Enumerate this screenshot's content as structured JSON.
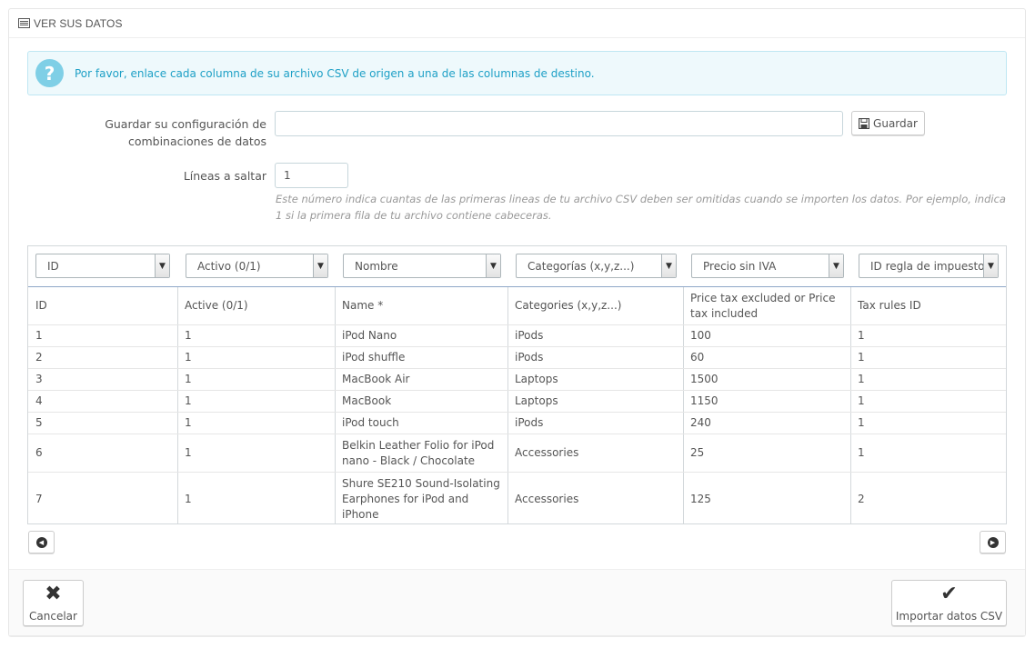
{
  "panel": {
    "title": "VER SUS DATOS",
    "icon": "list-icon"
  },
  "alert": {
    "icon": "question-icon",
    "text": "Por favor, enlace cada columna de su archivo CSV de origen a una de las columnas de destino."
  },
  "config": {
    "label_line1": "Guardar su configuración de",
    "label_line2": "combinaciones de datos",
    "value": "",
    "save_label": "Guardar",
    "save_icon": "save-icon"
  },
  "skip": {
    "label": "Líneas a saltar",
    "value": "1",
    "help": "Este número indica cuantas de las primeras lineas de tu archivo CSV deben ser omitidas cuando se importen los datos. Por ejemplo, indica 1 si la primera fila de tu archivo contiene cabeceras."
  },
  "mapping": [
    "ID",
    "Activo (0/1)",
    "Nombre",
    "Categorías (x,y,z...)",
    "Precio sin IVA",
    "ID regla de impuesto"
  ],
  "table": {
    "headers": [
      "ID",
      "Active (0/1)",
      "Name *",
      "Categories (x,y,z...)",
      "Price tax excluded or Price tax included",
      "Tax rules ID"
    ],
    "rows": [
      [
        "1",
        "1",
        "iPod Nano",
        "iPods",
        "100",
        "1"
      ],
      [
        "2",
        "1",
        "iPod shuffle",
        "iPods",
        "60",
        "1"
      ],
      [
        "3",
        "1",
        "MacBook Air",
        "Laptops",
        "1500",
        "1"
      ],
      [
        "4",
        "1",
        "MacBook",
        "Laptops",
        "1150",
        "1"
      ],
      [
        "5",
        "1",
        "iPod touch",
        "iPods",
        "240",
        "1"
      ],
      [
        "6",
        "1",
        "Belkin Leather Folio for iPod nano - Black / Chocolate",
        "Accessories",
        "25",
        "1"
      ],
      [
        "7",
        "1",
        "Shure SE210 Sound-Isolating Earphones for iPod and iPhone",
        "Accessories",
        "125",
        "2"
      ]
    ]
  },
  "pager": {
    "prev_icon": "chevron-left-circle-icon",
    "next_icon": "chevron-right-circle-icon"
  },
  "footer": {
    "cancel_label": "Cancelar",
    "cancel_icon": "close-icon",
    "import_label": "Importar datos CSV",
    "import_icon": "check-icon"
  },
  "colors": {
    "accent": "#1ea0c6",
    "alert_bg": "#eef9fc",
    "grid_header_border": "#8fa7c8"
  }
}
